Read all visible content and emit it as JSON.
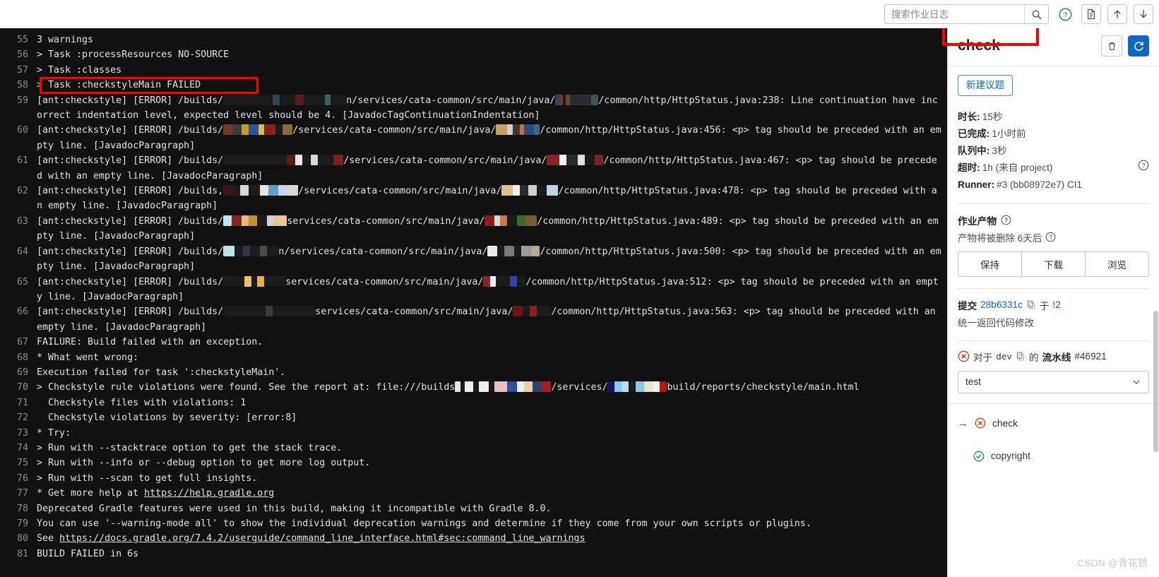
{
  "topbar": {
    "search_placeholder": "搜索作业日志",
    "search_value": "",
    "search_icon": "search-icon",
    "help_icon": "question-circle-icon",
    "raw_icon": "file-document-icon",
    "scroll_top_icon": "scroll-to-top-icon",
    "scroll_bottom_icon": "scroll-to-bottom-icon"
  },
  "sidebar": {
    "title": "check",
    "erase_icon": "trash-icon",
    "retry_icon": "retry-refresh-icon",
    "new_issue_label": "新建议题",
    "meta": [
      {
        "label": "时长:",
        "value": "15秒",
        "help": false
      },
      {
        "label": "已完成:",
        "value": "1小时前",
        "help": false
      },
      {
        "label": "队列中:",
        "value": "3秒",
        "help": false
      },
      {
        "label": "超时:",
        "value": "1h (来自 project)",
        "help": true
      },
      {
        "label": "Runner:",
        "value": "#3 (bb08972e7) CI1",
        "help": false
      }
    ],
    "artifacts": {
      "title": "作业产物",
      "title_help": "help-icon",
      "expiry_text": "产物将被删除 6天后",
      "expiry_help": "help-icon",
      "buttons": [
        "保持",
        "下载",
        "浏览"
      ]
    },
    "commit": {
      "label": "提交",
      "sha": "28b6331c",
      "copy_icon": "copy-icon",
      "preposition": "于",
      "mr_ref": "!2",
      "message": "统一返回代码修改"
    },
    "pipeline": {
      "status_icon": "failed-status-icon",
      "prefix": "对于",
      "branch": "dev",
      "copy_icon": "copy-icon",
      "middle": "的",
      "label": "流水线",
      "number": "#46921"
    },
    "stage_select": {
      "value": "test",
      "chevron_icon": "chevron-down-icon"
    },
    "jobs": [
      {
        "name": "check",
        "status": "failed",
        "current": true
      },
      {
        "name": "copyright",
        "status": "passed",
        "current": false
      }
    ]
  },
  "watermark": "CSDN @青花锁",
  "log": {
    "lines": [
      {
        "n": "55",
        "parts": [
          {
            "t": "3 warnings"
          }
        ]
      },
      {
        "n": "56",
        "parts": [
          {
            "t": "> Task :processResources NO-SOURCE"
          }
        ]
      },
      {
        "n": "57",
        "parts": [
          {
            "t": "> Task :classes"
          }
        ]
      },
      {
        "n": "58",
        "parts": [
          {
            "t": "> Task :checkstyleMain FAILED"
          }
        ],
        "highlight": true
      },
      {
        "n": "59",
        "parts": [
          {
            "t": "[ant:checkstyle] [ERROR] /builds/"
          },
          {
            "redact": [
              [
                70,
                "#1b1b1b"
              ],
              [
                10,
                "#2c4750"
              ],
              [
                22,
                "#1b1b1b"
              ],
              [
                12,
                "#5a1d1d"
              ],
              [
                30,
                "#1b1b1b"
              ],
              [
                8,
                "#3a5f6e"
              ],
              [
                22,
                "#1b1b1b"
              ]
            ]
          },
          {
            "t": "n/services/cata-common/src/main/java/"
          },
          {
            "redact": [
              [
                6,
                "#26455c"
              ],
              [
                5,
                "#7a3030"
              ],
              [
                4,
                "#1b1b1b"
              ],
              [
                6,
                "#6a4a2a"
              ],
              [
                30,
                "#2a2a33"
              ],
              [
                10,
                "#3a5560"
              ]
            ]
          },
          {
            "t": "/common/http/HttpStatus.java:238: Line continuation have incorrect indentation level, expected level should be 4. [JavadocTagContinuationIndentation]"
          }
        ]
      },
      {
        "n": "60",
        "parts": [
          {
            "t": "[ant:checkstyle] [ERROR] /builds/"
          },
          {
            "redact": [
              [
                14,
                "#6b3a2a"
              ],
              [
                12,
                "#3a3a3a"
              ],
              [
                10,
                "#c8a020"
              ],
              [
                14,
                "#2a55a0"
              ],
              [
                8,
                "#d8c050"
              ],
              [
                16,
                "#8a2020"
              ],
              [
                10,
                "#1b1b1b"
              ],
              [
                14,
                "#8a6a30"
              ]
            ]
          },
          {
            "t": "/services/cata-common/src/main/java/"
          },
          {
            "redact": [
              [
                16,
                "#c8a060"
              ],
              [
                8,
                "#d0d0d0"
              ],
              [
                10,
                "#3a3a3a"
              ],
              [
                6,
                "#c87040"
              ],
              [
                14,
                "#2a4a8a"
              ],
              [
                8,
                "#3a6a8a"
              ]
            ]
          },
          {
            "t": "/common/http/HttpStatus.java:456: <p> tag should be preceded with an empty line. [JavadocParagraph]"
          }
        ]
      },
      {
        "n": "61",
        "parts": [
          {
            "t": "[ant:checkstyle] [ERROR] /builds/"
          },
          {
            "redact": [
              [
                90,
                "#1b1b1b"
              ],
              [
                12,
                "#5a1a1a"
              ],
              [
                10,
                "#e8e8e8"
              ],
              [
                12,
                "#1b1b1b"
              ],
              [
                10,
                "#d8d8d8"
              ],
              [
                22,
                "#1b1b1b"
              ],
              [
                14,
                "#7a2020"
              ]
            ]
          },
          {
            "t": "/services/cata-common/src/main/java/"
          },
          {
            "redact": [
              [
                18,
                "#8a2424"
              ],
              [
                10,
                "#f0f0f0"
              ],
              [
                16,
                "#2b2b2b"
              ],
              [
                10,
                "#e0e0e0"
              ],
              [
                14,
                "#1b1b1b"
              ],
              [
                12,
                "#7a2424"
              ]
            ]
          },
          {
            "t": "/common/http/HttpStatus.java:467: <p> tag should be preceded with an empty line. [JavadocParagraph]"
          }
        ]
      },
      {
        "n": "62",
        "parts": [
          {
            "t": "[ant:checkstyle] [ERROR] /builds,"
          },
          {
            "redact": [
              [
                14,
                "#401414"
              ],
              [
                10,
                "#1b1b1b"
              ],
              [
                12,
                "#d8d8d8"
              ],
              [
                16,
                "#1b1b1b"
              ],
              [
                12,
                "#e8e4dc"
              ],
              [
                14,
                "#60a0c8"
              ],
              [
                12,
                "#c8d8e8"
              ],
              [
                16,
                "#d8d8d8"
              ]
            ]
          },
          {
            "t": "/services/cata-common/src/main/java/"
          },
          {
            "redact": [
              [
                16,
                "#e0c090"
              ],
              [
                10,
                "#f0f0f0"
              ],
              [
                12,
                "#2b2b2b"
              ],
              [
                12,
                "#d0d0d0"
              ],
              [
                14,
                "#1b1b1b"
              ],
              [
                16,
                "#bcd4e4"
              ]
            ]
          },
          {
            "t": "/common/http/HttpStatus.java:478: <p> tag should be preceded with an empty line. [JavadocParagraph]"
          }
        ]
      },
      {
        "n": "63",
        "parts": [
          {
            "t": "[ant:checkstyle] [ERROR] /builds/"
          },
          {
            "redact": [
              [
                12,
                "#bce8ec"
              ],
              [
                14,
                "#8a2424"
              ],
              [
                10,
                "#e8b870"
              ],
              [
                12,
                "#c89030"
              ],
              [
                14,
                "#1b1b1b"
              ],
              [
                10,
                "#d0d0d0"
              ],
              [
                18,
                "#e8c890"
              ]
            ]
          },
          {
            "t": "services/cata-common/src/main/java/"
          },
          {
            "redact": [
              [
                14,
                "#8a1c1c"
              ],
              [
                8,
                "#d8d8d8"
              ],
              [
                10,
                "#c87840"
              ],
              [
                14,
                "#1b1b1b"
              ],
              [
                12,
                "#3a6a30"
              ],
              [
                16,
                "#7a5a30"
              ]
            ]
          },
          {
            "t": "/common/http/HttpStatus.java:489: <p> tag should be preceded with an empty line. [JavadocParagraph]"
          }
        ]
      },
      {
        "n": "64",
        "parts": [
          {
            "t": "[ant:checkstyle] [ERROR] /builds/"
          },
          {
            "redact": [
              [
                16,
                "#bce4ec"
              ],
              [
                12,
                "#1b1b1b"
              ],
              [
                10,
                "#2a3a4a"
              ],
              [
                14,
                "#1b1b1b"
              ],
              [
                10,
                "#4a4a52"
              ],
              [
                16,
                "#1b1b1b"
              ]
            ]
          },
          {
            "t": "n/services/cata-common/src/main/java/"
          },
          {
            "redact": [
              [
                14,
                "#e8ece0"
              ],
              [
                10,
                "#1b1b1b"
              ],
              [
                14,
                "#7a7a7a"
              ],
              [
                10,
                "#1b1b1b"
              ],
              [
                14,
                "#9a9a9a"
              ],
              [
                12,
                "#b4a890"
              ]
            ]
          },
          {
            "t": "/common/http/HttpStatus.java:500: <p> tag should be preceded with an empty line. [JavadocParagraph]"
          }
        ]
      },
      {
        "n": "65",
        "parts": [
          {
            "t": "[ant:checkstyle] [ERROR] /builds/"
          },
          {
            "redact": [
              [
                30,
                "#1b1b1b"
              ],
              [
                10,
                "#e8c068"
              ],
              [
                8,
                "#1b1b1b"
              ],
              [
                10,
                "#e8b040"
              ],
              [
                30,
                "#1b1b1b"
              ]
            ]
          },
          {
            "t": "services/cata-common/src/main/java/"
          },
          {
            "redact": [
              [
                10,
                "#8a2424"
              ],
              [
                8,
                "#f0f0f0"
              ],
              [
                20,
                "#1b1b1b"
              ],
              [
                10,
                "#2a44a8"
              ],
              [
                12,
                "#1b1b1b"
              ]
            ]
          },
          {
            "t": "/common/http/HttpStatus.java:512: <p> tag should be preceded with an empty line. [JavadocParagraph]"
          }
        ]
      },
      {
        "n": "66",
        "parts": [
          {
            "t": "[ant:checkstyle] [ERROR] /builds/"
          },
          {
            "redact": [
              [
                60,
                "#1b1b1b"
              ],
              [
                10,
                "#3a3a3a"
              ],
              [
                60,
                "#1b1b1b"
              ]
            ]
          },
          {
            "t": "services/cata-common/src/main/java/"
          },
          {
            "redact": [
              [
                14,
                "#6a1414"
              ],
              [
                10,
                "#1b1b1b"
              ],
              [
                10,
                "#8a2020"
              ],
              [
                20,
                "#1b1b1b"
              ]
            ]
          },
          {
            "t": "/common/http/HttpStatus.java:563: <p> tag should be preceded with an empty line. [JavadocParagraph]"
          }
        ]
      },
      {
        "n": "67",
        "parts": [
          {
            "t": "FAILURE: Build failed with an exception."
          }
        ]
      },
      {
        "n": "68",
        "parts": [
          {
            "t": "* What went wrong:"
          }
        ]
      },
      {
        "n": "69",
        "parts": [
          {
            "t": "Execution failed for task ':checkstyleMain'."
          }
        ]
      },
      {
        "n": "70",
        "parts": [
          {
            "t": "> Checkstyle rule violations were found. See the report at: file:///builds"
          },
          {
            "redact": [
              [
                8,
                "#e8e8e8"
              ],
              [
                6,
                "#1b1b1b"
              ],
              [
                12,
                "#f0f0f0"
              ],
              [
                8,
                "#1b1b1b"
              ],
              [
                14,
                "#f0f0f0"
              ],
              [
                8,
                "#1b1b1b"
              ],
              [
                18,
                "#e8c0c0"
              ],
              [
                14,
                "#2a50a0"
              ],
              [
                10,
                "#f0f0f0"
              ],
              [
                12,
                "#e8d0b0"
              ],
              [
                12,
                "#2a4478"
              ],
              [
                14,
                "#a02020"
              ]
            ]
          },
          {
            "t": "/services/"
          },
          {
            "redact": [
              [
                10,
                "#141466"
              ],
              [
                10,
                "#8cc8e8"
              ],
              [
                10,
                "#b4dcf0"
              ],
              [
                10,
                "#1b1b1b"
              ],
              [
                12,
                "#8cc8e8"
              ],
              [
                12,
                "#e8e4c8"
              ],
              [
                10,
                "#f0f0f0"
              ],
              [
                10,
                "#b01818"
              ]
            ]
          },
          {
            "t": "build/reports/checkstyle/main.html"
          }
        ]
      },
      {
        "n": "71",
        "parts": [
          {
            "t": "  Checkstyle files with violations: 1"
          }
        ]
      },
      {
        "n": "72",
        "parts": [
          {
            "t": "  Checkstyle violations by severity: [error:8]"
          }
        ]
      },
      {
        "n": "73",
        "parts": [
          {
            "t": "* Try:"
          }
        ]
      },
      {
        "n": "74",
        "parts": [
          {
            "t": "> Run with --stacktrace option to get the stack trace."
          }
        ]
      },
      {
        "n": "75",
        "parts": [
          {
            "t": "> Run with --info or --debug option to get more log output."
          }
        ]
      },
      {
        "n": "76",
        "parts": [
          {
            "t": "> Run with --scan to get full insights."
          }
        ]
      },
      {
        "n": "77",
        "parts": [
          {
            "t": "* Get more help at "
          },
          {
            "t": "https://help.gradle.org",
            "link": true
          }
        ]
      },
      {
        "n": "78",
        "parts": [
          {
            "t": "Deprecated Gradle features were used in this build, making it incompatible with Gradle 8.0."
          }
        ]
      },
      {
        "n": "79",
        "parts": [
          {
            "t": "You can use '--warning-mode all' to show the individual deprecation warnings and determine if they come from your own scripts or plugins."
          }
        ]
      },
      {
        "n": "80",
        "parts": [
          {
            "t": "See "
          },
          {
            "t": "https://docs.gradle.org/7.4.2/userguide/command_line_interface.html#sec:command_line_warnings",
            "link": true
          }
        ]
      },
      {
        "n": "81",
        "parts": [
          {
            "t": "BUILD FAILED in 6s"
          }
        ]
      }
    ]
  },
  "colors": {
    "annotation_red": "#fe0000",
    "log_bg": "#111111",
    "accent_blue": "#1068bf",
    "status_failed": "#dd2b0e",
    "status_passed": "#108548"
  }
}
